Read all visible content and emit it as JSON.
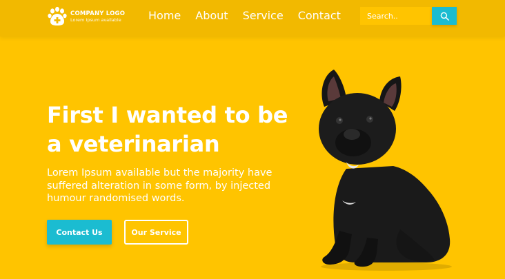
{
  "header": {
    "logo": {
      "icon": "paw-plus-icon",
      "title": "COMPANY LOGO",
      "tagline": "Lorem Ipsum available"
    },
    "nav": [
      {
        "label": "Home"
      },
      {
        "label": "About"
      },
      {
        "label": "Service"
      },
      {
        "label": "Contact"
      }
    ],
    "search": {
      "placeholder": "Search..",
      "button_icon": "search-icon"
    }
  },
  "hero": {
    "title_line1": "First I wanted to be",
    "title_line2": "a veterinarian",
    "description": "Lorem Ipsum available but the majority have suffered alteration in some form, by injected humour randomised words.",
    "primary_button": "Contact Us",
    "secondary_button": "Our Service",
    "image": "french-bulldog-photo"
  },
  "colors": {
    "background": "#ffc400",
    "header": "#f2b900",
    "accent": "#1bbcd1",
    "text": "#ffffff"
  }
}
